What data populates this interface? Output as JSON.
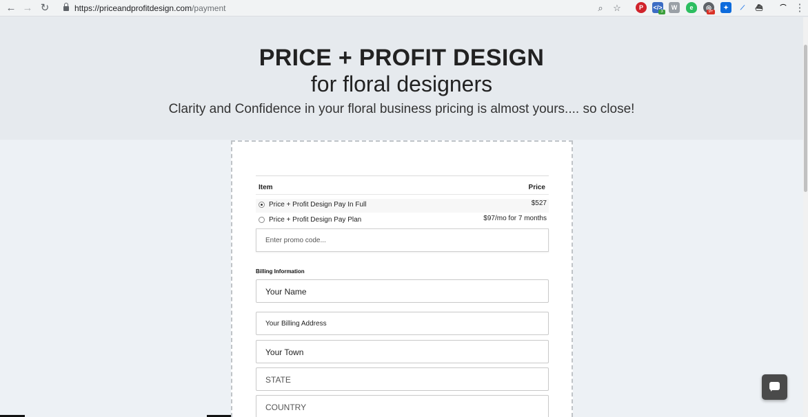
{
  "browser": {
    "url_host": "https://priceandprofitdesign.com",
    "url_path": "/payment",
    "ext_badges": [
      "3",
      "9+"
    ],
    "colors": {
      "pinterest": "#d0232b",
      "evernote": "#2dbe60",
      "dropbox": "#0d6bdc"
    }
  },
  "hero": {
    "title": "PRICE + PROFIT DESIGN",
    "subtitle": "for floral designers",
    "tagline": "Clarity and Confidence in your floral business pricing is almost yours.... so close!"
  },
  "order": {
    "header_item": "Item",
    "header_price": "Price",
    "options": [
      {
        "label": "Price + Profit Design Pay In Full",
        "price": "$527",
        "selected": true
      },
      {
        "label": "Price + Profit Design Pay Plan",
        "price": "$97/mo for 7 months",
        "selected": false
      }
    ],
    "promo_placeholder": "Enter promo code..."
  },
  "billing": {
    "heading": "Billing Information",
    "name": "Your Name",
    "address": "Your Billing Address",
    "town": "Your Town",
    "state": "STATE",
    "country": "COUNTRY"
  }
}
